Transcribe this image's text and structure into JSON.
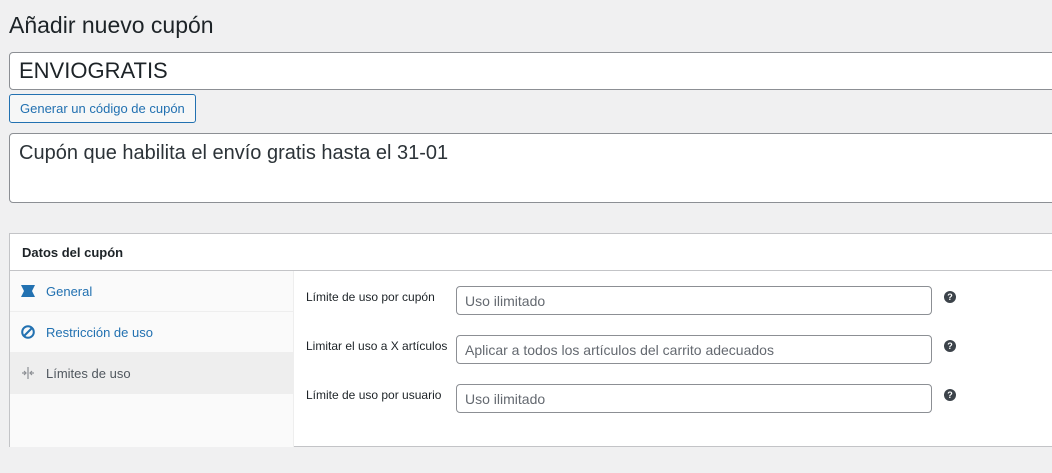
{
  "page": {
    "title": "Añadir nuevo cupón"
  },
  "coupon": {
    "code_value": "ENVIOGRATIS",
    "generate_button_label": "Generar un código de cupón",
    "description_value": "Cupón que habilita el envío gratis hasta el 31-01"
  },
  "coupon_data": {
    "title": "Datos del cupón",
    "tabs": [
      {
        "label": "General",
        "icon": "ticket-icon",
        "active": false
      },
      {
        "label": "Restricción de uso",
        "icon": "block-icon",
        "active": false
      },
      {
        "label": "Límites de uso",
        "icon": "arrows-icon",
        "active": true
      }
    ],
    "fields": [
      {
        "label": "Límite de uso por cupón",
        "placeholder": "Uso ilimitado"
      },
      {
        "label": "Limitar el uso a X artículos",
        "placeholder": "Aplicar a todos los artículos del carrito adecuados"
      },
      {
        "label": "Límite de uso por usuario",
        "placeholder": "Uso ilimitado"
      }
    ],
    "help_glyph": "?"
  },
  "colors": {
    "background": "#f0f0f1",
    "link": "#2271b1",
    "border": "#8c8f94"
  }
}
